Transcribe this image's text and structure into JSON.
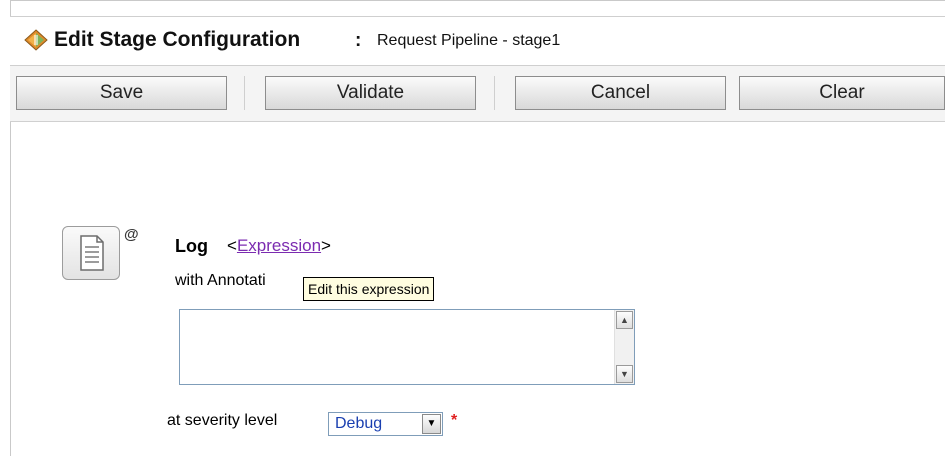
{
  "header": {
    "title": "Edit Stage Configuration",
    "separator": ":",
    "subtitle": "Request Pipeline - stage1",
    "icon": "stage-config-icon"
  },
  "toolbar": {
    "save_label": "Save",
    "validate_label": "Validate",
    "cancel_label": "Cancel",
    "clear_label": "Clear"
  },
  "action": {
    "icon": "log-document-icon",
    "annotation_icon": "@",
    "label": "Log",
    "expression_open": "<",
    "expression_link": "Expression",
    "expression_close": ">",
    "annotation_label": "with Annotati",
    "tooltip": "Edit this expression",
    "annotation_value": "",
    "severity_label": "at severity level",
    "severity_value": "Debug",
    "required_marker": "*"
  },
  "colors": {
    "link": "#7b2bb0",
    "required": "#e02020",
    "select_text": "#1a3fb0"
  }
}
